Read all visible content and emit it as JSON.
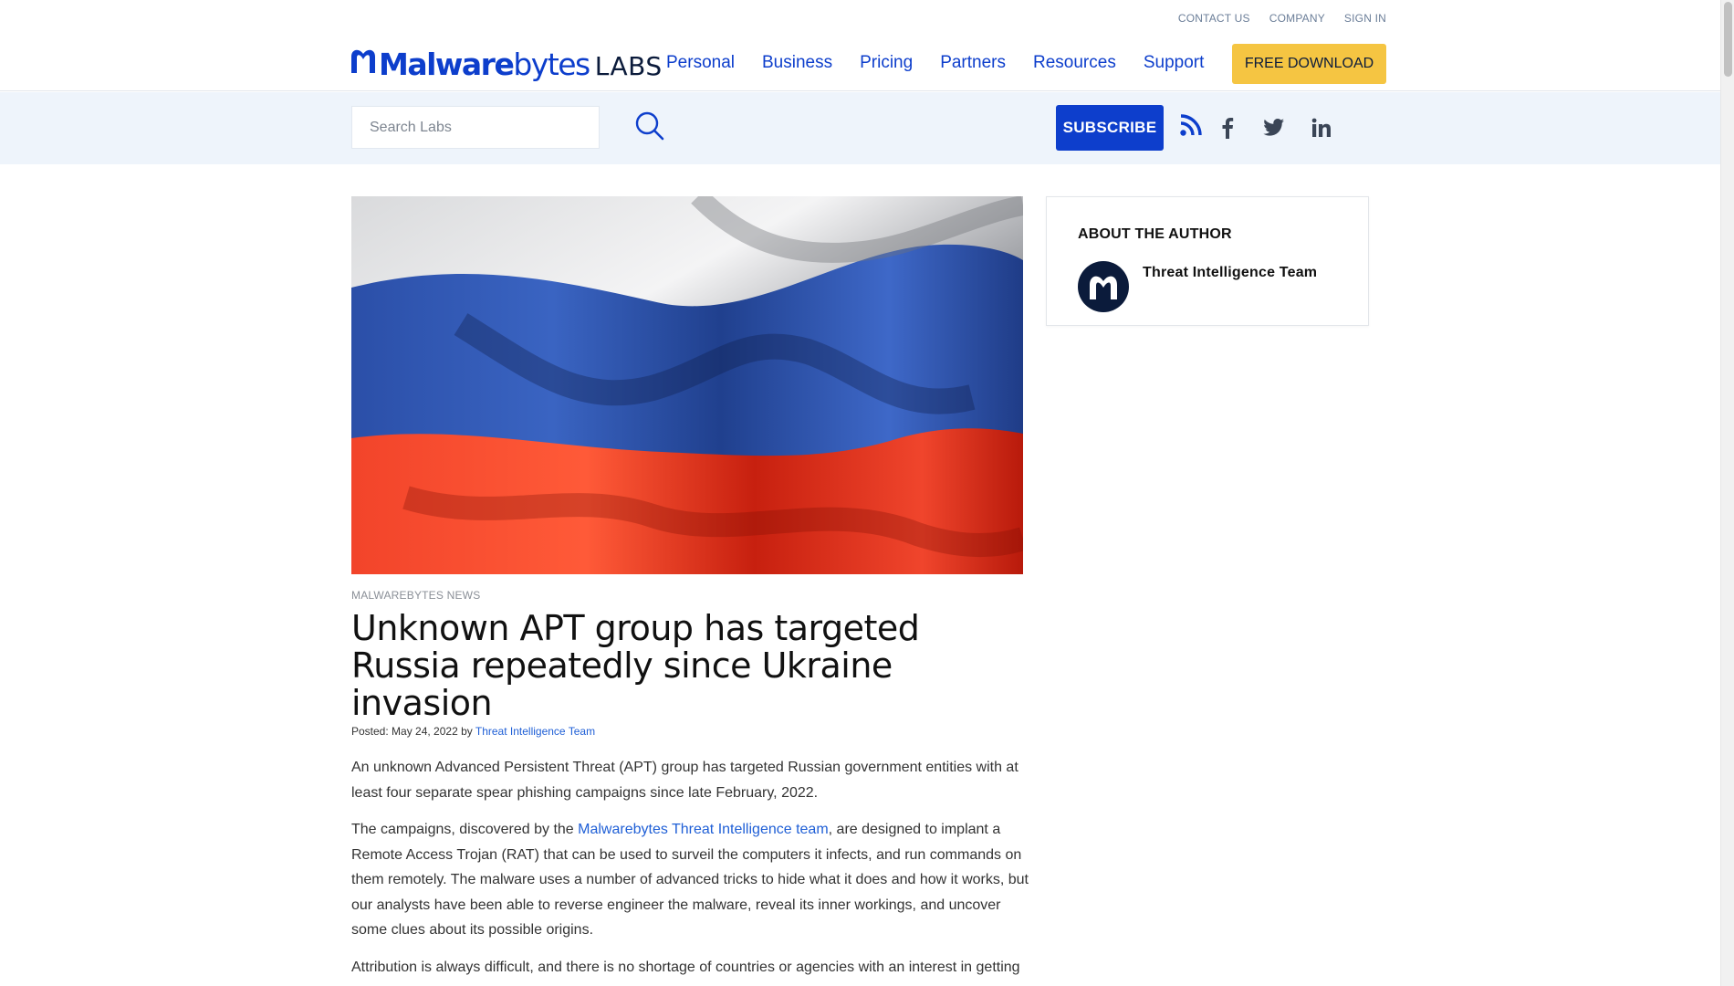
{
  "header": {
    "top_links": [
      "CONTACT US",
      "COMPANY",
      "SIGN IN"
    ],
    "logo": {
      "word_bold": "Malware",
      "word_light": "bytes",
      "suffix": "LABS"
    },
    "nav": [
      "Personal",
      "Business",
      "Pricing",
      "Partners",
      "Resources",
      "Support"
    ],
    "download_label": "FREE DOWNLOAD"
  },
  "search": {
    "placeholder": "Search Labs",
    "subscribe_label": "SUBSCRIBE",
    "social_icons": [
      "rss-icon",
      "facebook-icon",
      "twitter-icon",
      "linkedin-icon"
    ]
  },
  "article": {
    "hero_image": "russian-flag",
    "category": "MALWAREBYTES NEWS",
    "title": "Unknown APT group has targeted Russia repeatedly since Ukraine invasion",
    "meta": {
      "posted_prefix": "Posted: ",
      "date": "May 24, 2022",
      "by": " by ",
      "author": "Threat Intelligence Team"
    },
    "paragraphs": [
      {
        "text": "An unknown Advanced Persistent Threat (APT) group has targeted Russian government entities with at least four separate spear phishing campaigns since late February, 2022."
      },
      {
        "before": "The campaigns, discovered by the ",
        "link": "Malwarebytes Threat Intelligence team",
        "after": ", are designed to implant a Remote Access Trojan (RAT) that can be used to surveil the computers it infects, and run commands on them remotely. The malware uses a number of advanced tricks to hide what it does and how it works, but our analysts have been able to reverse engineer the malware, reveal its inner workings, and uncover some clues about its possible origins."
      },
      {
        "text": "Attribution is always difficult, and there is no shortage of countries or agencies with an interest in getting"
      }
    ]
  },
  "sidebar": {
    "heading": "ABOUT THE AUTHOR",
    "author_name": "Threat Intelligence Team"
  },
  "colors": {
    "brand_blue": "#0d3ecc",
    "download_yellow": "#f5c542",
    "strip_bg": "#eef4fb",
    "avatar_bg": "#0b1b3b"
  }
}
